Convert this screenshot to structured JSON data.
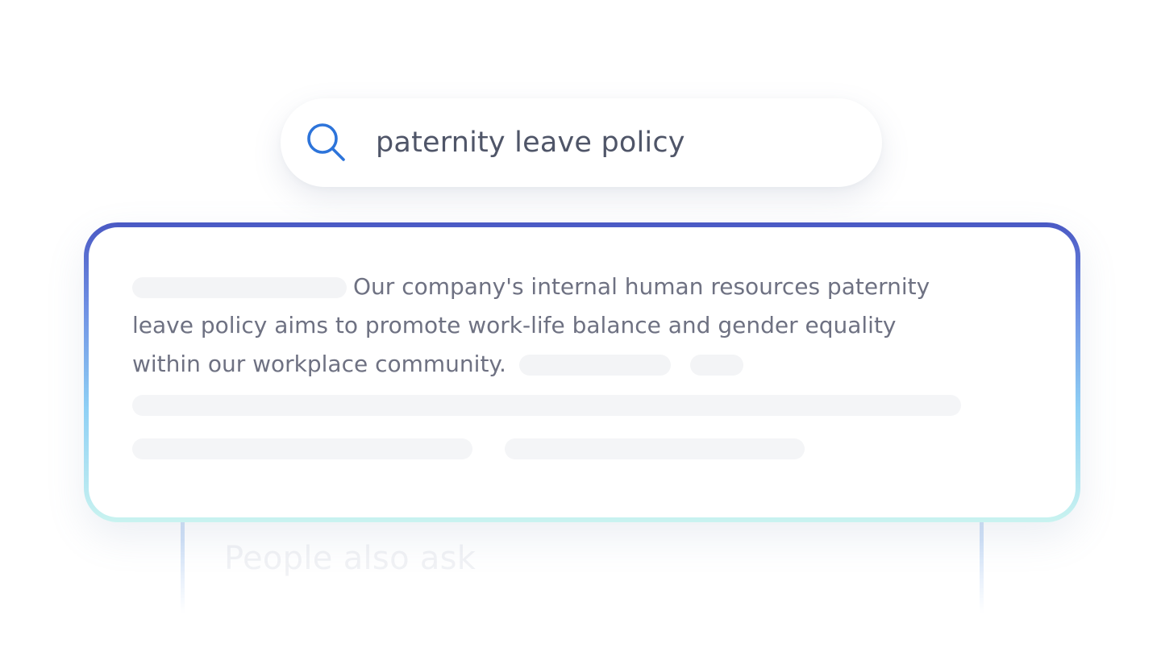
{
  "search": {
    "query": "paternity leave policy",
    "icon": "search-icon",
    "icon_color": "#2d74da"
  },
  "result": {
    "snippet": "Our company's internal human resources paternity leave policy aims to promote work-life balance and gender equality within our workplace community.",
    "border_gradient": [
      "#4a59c4",
      "#8fd0f5",
      "#c9f3f0"
    ]
  },
  "related": {
    "title": "People also ask"
  }
}
